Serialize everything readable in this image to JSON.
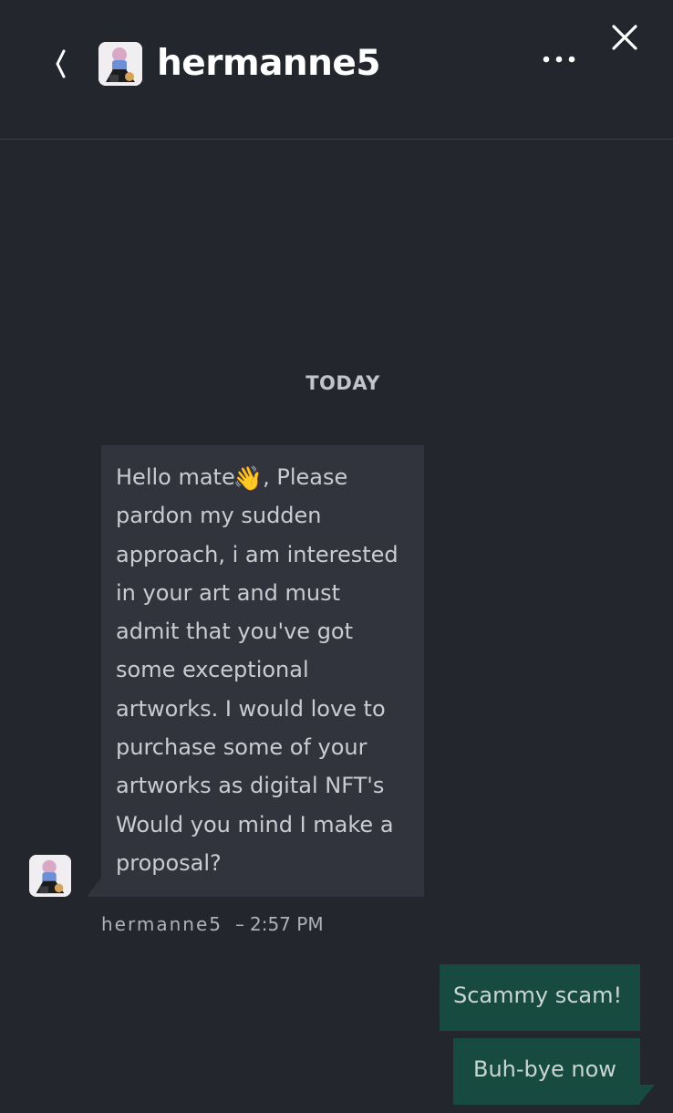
{
  "header": {
    "username": "hermanne5"
  },
  "icons": {
    "back": "chevron-left-icon",
    "more": "more-horizontal-icon",
    "close": "close-icon"
  },
  "conversation": {
    "date_separator": "TODAY",
    "incoming": {
      "sender": "hermanne5",
      "dash": "–",
      "time": "2:57 PM",
      "lines": [
        "Hello mate",
        ", Please",
        "pardon my sudden",
        "approach, i am interested",
        "in your art and must",
        "admit that you've got",
        "some exceptional",
        "artworks. I would love to",
        "purchase some of your",
        "artworks as digital NFT's",
        "Would you mind I make a",
        "proposal?"
      ],
      "emoji": "👋"
    },
    "outgoing": [
      {
        "text": "Scammy scam!"
      },
      {
        "text": "Buh-bye now"
      }
    ]
  },
  "colors": {
    "background": "#23262d",
    "incoming_bubble": "#31343c",
    "outgoing_bubble": "#184b3f",
    "title_text": "#ffffff"
  }
}
